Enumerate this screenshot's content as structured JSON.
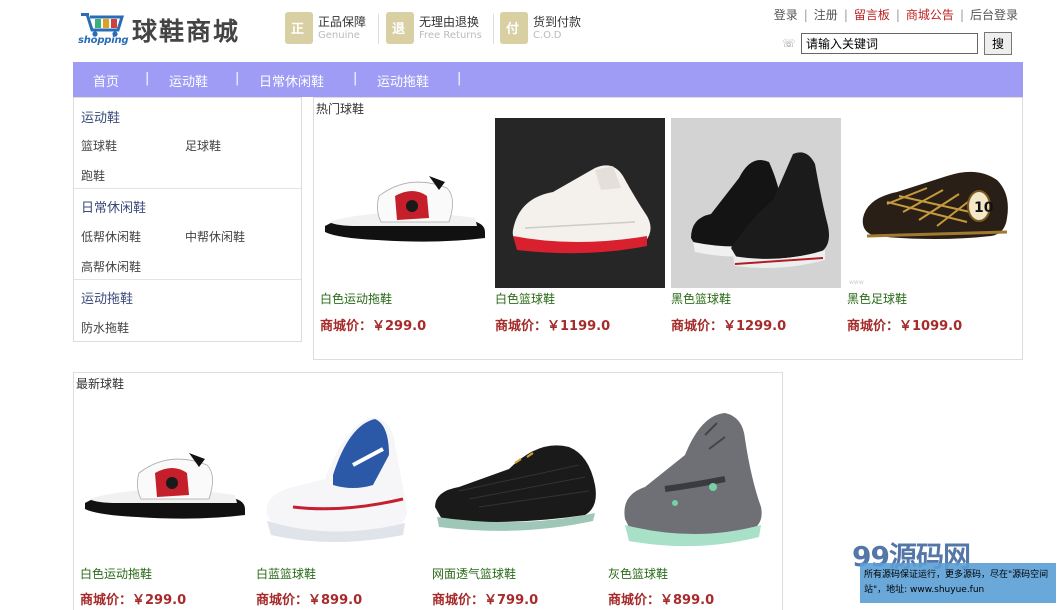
{
  "header": {
    "logo_word": "shopping",
    "brand": "球鞋商城",
    "features": [
      {
        "icon": "shield-icon",
        "glyph": "正",
        "cn": "正品保障",
        "en": "Genuine"
      },
      {
        "icon": "return-icon",
        "glyph": "退",
        "cn": "无理由退换",
        "en": "Free Returns"
      },
      {
        "icon": "cod-icon",
        "glyph": "付",
        "cn": "货到付款",
        "en": "C.O.D"
      }
    ],
    "top_links": [
      "登录",
      "注册",
      "留言板",
      "商城公告",
      "后台登录"
    ],
    "search_placeholder": "请输入关键词",
    "search_button": "搜"
  },
  "nav": [
    "首页",
    "运动鞋",
    "日常休闲鞋",
    "运动拖鞋"
  ],
  "categories": [
    {
      "title": "运动鞋",
      "links": [
        "篮球鞋",
        "足球鞋",
        "跑鞋"
      ]
    },
    {
      "title": "日常休闲鞋",
      "links": [
        "低帮休闲鞋",
        "中帮休闲鞋",
        "高帮休闲鞋"
      ]
    },
    {
      "title": "运动拖鞋",
      "links": [
        "防水拖鞋"
      ]
    }
  ],
  "hot": {
    "title": "热门球鞋",
    "products": [
      {
        "name": "白色运动拖鞋",
        "price": "商城价：￥299.0"
      },
      {
        "name": "白色篮球鞋",
        "price": "商城价：￥1199.0"
      },
      {
        "name": "黑色篮球鞋",
        "price": "商城价：￥1299.0"
      },
      {
        "name": "黑色足球鞋",
        "price": "商城价：￥1099.0"
      }
    ]
  },
  "new": {
    "title": "最新球鞋",
    "products": [
      {
        "name": "白色运动拖鞋",
        "price": "商城价：￥299.0"
      },
      {
        "name": "白蓝篮球鞋",
        "price": "商城价：￥899.0"
      },
      {
        "name": "网面透气篮球鞋",
        "price": "商城价：￥799.0"
      },
      {
        "name": "灰色篮球鞋",
        "price": "商城价：￥899.0"
      }
    ]
  },
  "watermark": {
    "logo": "99源码网",
    "text": "所有源码保证运行，更多源码，尽在\"源码空间站\"，地址: www.shuyue.fun"
  }
}
